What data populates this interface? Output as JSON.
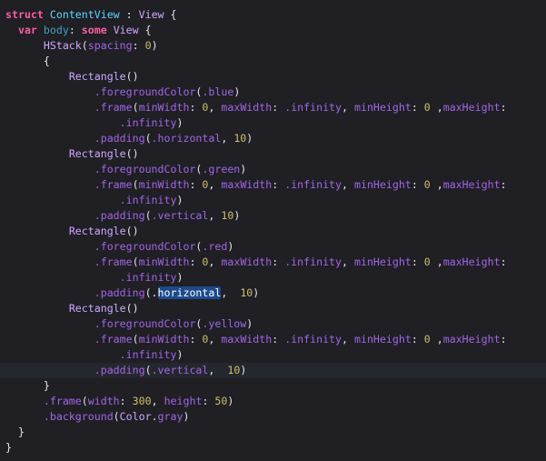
{
  "editor": {
    "colors": {
      "background": "#1f1f24",
      "current_line": "#25272e",
      "selection": "#1c4a8a"
    },
    "current_line_index": 23,
    "lines": [
      [
        [
          "struct",
          "kw"
        ],
        [
          " ",
          "plain"
        ],
        [
          "ContentView",
          "decl"
        ],
        [
          " : ",
          "plain"
        ],
        [
          "View",
          "type"
        ],
        [
          " {",
          "plain"
        ]
      ],
      [
        [
          "  ",
          "plain"
        ],
        [
          "var",
          "kw"
        ],
        [
          " ",
          "plain"
        ],
        [
          "body",
          "var"
        ],
        [
          ": ",
          "plain"
        ],
        [
          "some",
          "kw"
        ],
        [
          " ",
          "plain"
        ],
        [
          "View",
          "type"
        ],
        [
          " {",
          "plain"
        ]
      ],
      [
        [
          "      ",
          "plain"
        ],
        [
          "HStack",
          "type"
        ],
        [
          "(",
          "plain"
        ],
        [
          "spacing",
          "fn"
        ],
        [
          ": ",
          "plain"
        ],
        [
          "0",
          "num"
        ],
        [
          ")",
          "plain"
        ]
      ],
      [
        [
          "      {",
          "plain"
        ]
      ],
      [
        [
          "          ",
          "plain"
        ],
        [
          "Rectangle",
          "type"
        ],
        [
          "()",
          "plain"
        ]
      ],
      [
        [
          "              ",
          "plain"
        ],
        [
          ".foregroundColor",
          "fn"
        ],
        [
          "(",
          "plain"
        ],
        [
          ".blue",
          "fn"
        ],
        [
          ")",
          "plain"
        ]
      ],
      [
        [
          "              ",
          "plain"
        ],
        [
          ".frame",
          "fn"
        ],
        [
          "(",
          "plain"
        ],
        [
          "minWidth",
          "fn"
        ],
        [
          ": ",
          "plain"
        ],
        [
          "0",
          "num"
        ],
        [
          ", ",
          "plain"
        ],
        [
          "maxWidth",
          "fn"
        ],
        [
          ": ",
          "plain"
        ],
        [
          ".infinity",
          "fn"
        ],
        [
          ", ",
          "plain"
        ],
        [
          "minHeight",
          "fn"
        ],
        [
          ": ",
          "plain"
        ],
        [
          "0",
          "num"
        ],
        [
          " ,",
          "plain"
        ],
        [
          "maxHeight",
          "fn"
        ],
        [
          ":",
          "plain"
        ]
      ],
      [
        [
          "                  ",
          "plain"
        ],
        [
          ".infinity",
          "fn"
        ],
        [
          ")",
          "plain"
        ]
      ],
      [
        [
          "              ",
          "plain"
        ],
        [
          ".padding",
          "fn"
        ],
        [
          "(",
          "plain"
        ],
        [
          ".horizontal",
          "fn"
        ],
        [
          ", ",
          "plain"
        ],
        [
          "10",
          "num"
        ],
        [
          ")",
          "plain"
        ]
      ],
      [
        [
          "          ",
          "plain"
        ],
        [
          "Rectangle",
          "type"
        ],
        [
          "()",
          "plain"
        ]
      ],
      [
        [
          "              ",
          "plain"
        ],
        [
          ".foregroundColor",
          "fn"
        ],
        [
          "(",
          "plain"
        ],
        [
          ".green",
          "fn"
        ],
        [
          ")",
          "plain"
        ]
      ],
      [
        [
          "              ",
          "plain"
        ],
        [
          ".frame",
          "fn"
        ],
        [
          "(",
          "plain"
        ],
        [
          "minWidth",
          "fn"
        ],
        [
          ": ",
          "plain"
        ],
        [
          "0",
          "num"
        ],
        [
          ", ",
          "plain"
        ],
        [
          "maxWidth",
          "fn"
        ],
        [
          ": ",
          "plain"
        ],
        [
          ".infinity",
          "fn"
        ],
        [
          ", ",
          "plain"
        ],
        [
          "minHeight",
          "fn"
        ],
        [
          ": ",
          "plain"
        ],
        [
          "0",
          "num"
        ],
        [
          " ,",
          "plain"
        ],
        [
          "maxHeight",
          "fn"
        ],
        [
          ":",
          "plain"
        ]
      ],
      [
        [
          "                  ",
          "plain"
        ],
        [
          ".infinity",
          "fn"
        ],
        [
          ")",
          "plain"
        ]
      ],
      [
        [
          "              ",
          "plain"
        ],
        [
          ".padding",
          "fn"
        ],
        [
          "(",
          "plain"
        ],
        [
          ".vertical",
          "fn"
        ],
        [
          ", ",
          "plain"
        ],
        [
          "10",
          "num"
        ],
        [
          ")",
          "plain"
        ]
      ],
      [
        [
          "          ",
          "plain"
        ],
        [
          "Rectangle",
          "type"
        ],
        [
          "()",
          "plain"
        ]
      ],
      [
        [
          "              ",
          "plain"
        ],
        [
          ".foregroundColor",
          "fn"
        ],
        [
          "(",
          "plain"
        ],
        [
          ".red",
          "fn"
        ],
        [
          ")",
          "plain"
        ]
      ],
      [
        [
          "              ",
          "plain"
        ],
        [
          ".frame",
          "fn"
        ],
        [
          "(",
          "plain"
        ],
        [
          "minWidth",
          "fn"
        ],
        [
          ": ",
          "plain"
        ],
        [
          "0",
          "num"
        ],
        [
          ", ",
          "plain"
        ],
        [
          "maxWidth",
          "fn"
        ],
        [
          ": ",
          "plain"
        ],
        [
          ".infinity",
          "fn"
        ],
        [
          ", ",
          "plain"
        ],
        [
          "minHeight",
          "fn"
        ],
        [
          ": ",
          "plain"
        ],
        [
          "0",
          "num"
        ],
        [
          " ,",
          "plain"
        ],
        [
          "maxHeight",
          "fn"
        ],
        [
          ":",
          "plain"
        ]
      ],
      [
        [
          "                  ",
          "plain"
        ],
        [
          ".infinity",
          "fn"
        ],
        [
          ")",
          "plain"
        ]
      ],
      [
        [
          "              ",
          "plain"
        ],
        [
          ".padding",
          "fn"
        ],
        [
          "(.",
          "plain"
        ],
        [
          "horizontal",
          "sel"
        ],
        [
          ",  ",
          "plain"
        ],
        [
          "10",
          "num"
        ],
        [
          ")",
          "plain"
        ]
      ],
      [
        [
          "          ",
          "plain"
        ],
        [
          "Rectangle",
          "type"
        ],
        [
          "()",
          "plain"
        ]
      ],
      [
        [
          "              ",
          "plain"
        ],
        [
          ".foregroundColor",
          "fn"
        ],
        [
          "(",
          "plain"
        ],
        [
          ".yellow",
          "fn"
        ],
        [
          ")",
          "plain"
        ]
      ],
      [
        [
          "              ",
          "plain"
        ],
        [
          ".frame",
          "fn"
        ],
        [
          "(",
          "plain"
        ],
        [
          "minWidth",
          "fn"
        ],
        [
          ": ",
          "plain"
        ],
        [
          "0",
          "num"
        ],
        [
          ", ",
          "plain"
        ],
        [
          "maxWidth",
          "fn"
        ],
        [
          ": ",
          "plain"
        ],
        [
          ".infinity",
          "fn"
        ],
        [
          ", ",
          "plain"
        ],
        [
          "minHeight",
          "fn"
        ],
        [
          ": ",
          "plain"
        ],
        [
          "0",
          "num"
        ],
        [
          " ,",
          "plain"
        ],
        [
          "maxHeight",
          "fn"
        ],
        [
          ":",
          "plain"
        ]
      ],
      [
        [
          "                  ",
          "plain"
        ],
        [
          ".infinity",
          "fn"
        ],
        [
          ")",
          "plain"
        ]
      ],
      [
        [
          "              ",
          "plain"
        ],
        [
          ".padding",
          "fn"
        ],
        [
          "(",
          "plain"
        ],
        [
          ".vertical",
          "fn"
        ],
        [
          ",  ",
          "plain"
        ],
        [
          "10",
          "num"
        ],
        [
          ")",
          "plain"
        ]
      ],
      [
        [
          "      }",
          "plain"
        ]
      ],
      [
        [
          "      ",
          "plain"
        ],
        [
          ".frame",
          "fn"
        ],
        [
          "(",
          "plain"
        ],
        [
          "width",
          "fn"
        ],
        [
          ": ",
          "plain"
        ],
        [
          "300",
          "num"
        ],
        [
          ", ",
          "plain"
        ],
        [
          "height",
          "fn"
        ],
        [
          ": ",
          "plain"
        ],
        [
          "50",
          "num"
        ],
        [
          ")",
          "plain"
        ]
      ],
      [
        [
          "      ",
          "plain"
        ],
        [
          ".background",
          "fn"
        ],
        [
          "(",
          "plain"
        ],
        [
          "Color",
          "type"
        ],
        [
          ".",
          "plain"
        ],
        [
          "gray",
          "fn"
        ],
        [
          ")",
          "plain"
        ]
      ],
      [
        [
          "  }",
          "plain"
        ]
      ],
      [
        [
          "}",
          "plain"
        ]
      ]
    ]
  }
}
